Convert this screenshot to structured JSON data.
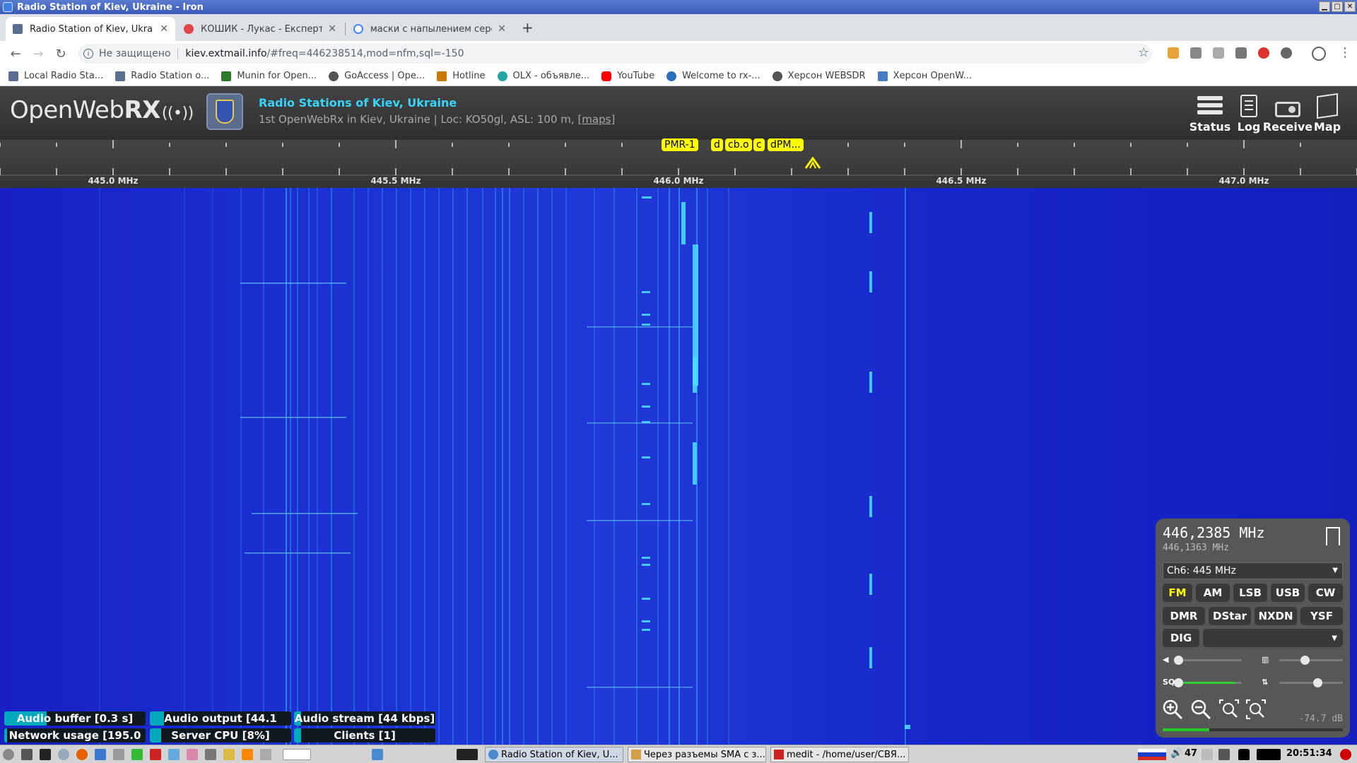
{
  "window": {
    "title": "Radio Station of Kiev, Ukraine - Iron"
  },
  "tabs": [
    {
      "label": "Radio Station of Kiev, Ukra",
      "active": true
    },
    {
      "label": "КОШИК - Лукас - Експерт",
      "active": false
    },
    {
      "label": "маски с напылением сере",
      "active": false
    }
  ],
  "address": {
    "security": "Не защищено",
    "host": "kiev.extmail.info",
    "path": "/#freq=446238514,mod=nfm,sql=-150"
  },
  "bookmarks": [
    "Local Radio Sta...",
    "Radio Station o...",
    "Munin for Open...",
    "GoAccess | Ope...",
    "Hotline",
    "OLX - объявле...",
    "YouTube",
    "Welcome to rx-...",
    "Херсон WEBSDR",
    "Херсон OpenW..."
  ],
  "owrx": {
    "logo_light": "OpenWeb",
    "logo_bold": "RX",
    "title": "Radio Stations of Kiev, Ukraine",
    "desc": "1st OpenWebRx in Kiev, Ukraine | Loc: KO50gl, ASL: 100 m,",
    "maps": "[maps]",
    "buttons": [
      "Status",
      "Log",
      "Receive",
      "Map"
    ]
  },
  "scale": {
    "labels": [
      "445.0 MHz",
      "445.5 MHz",
      "446.0 MHz",
      "446.5 MHz",
      "447.0 MHz"
    ]
  },
  "bookmark_tags": [
    "PMR-1",
    "d",
    "cb.o",
    "c",
    "dPM..."
  ],
  "status_bars": {
    "audio_buffer": {
      "label": "Audio buffer [0.3 s]",
      "fill": 0.3
    },
    "audio_output": {
      "label": "Audio output [44.1",
      "fill": 0.1
    },
    "audio_stream": {
      "label": "Audio stream [44 kbps]",
      "fill": 0.05
    },
    "network": {
      "label": "Network usage [195.0",
      "fill": 0.02
    },
    "server_cpu": {
      "label": "Server CPU [8%]",
      "fill": 0.08
    },
    "clients": {
      "label": "Clients [1]",
      "fill": 0.05
    }
  },
  "receiver": {
    "freq": "446,2385 MHz",
    "freq_secondary": "446,1363 MHz",
    "channel": "Ch6: 445 MHz",
    "modes_row1": [
      "FM",
      "AM",
      "LSB",
      "USB",
      "CW"
    ],
    "modes_row2": [
      "DMR",
      "DStar",
      "NXDN",
      "YSF"
    ],
    "dig_label": "DIG",
    "active_mode": "FM",
    "volume": 0.0,
    "nr": 0.4,
    "squelch": 0.0,
    "agc": 0.6,
    "sq_label": "SQ",
    "db": "-74.7 dB",
    "smeter": 0.26,
    "accent_color": "#ffff00"
  },
  "taskbar": {
    "tasks": [
      "Radio Station of Kiev, U...",
      "Через разъемы SMA с з...",
      "medit - /home/user/СВЯ..."
    ],
    "volume_level": "47",
    "clock": "20:51:34"
  }
}
